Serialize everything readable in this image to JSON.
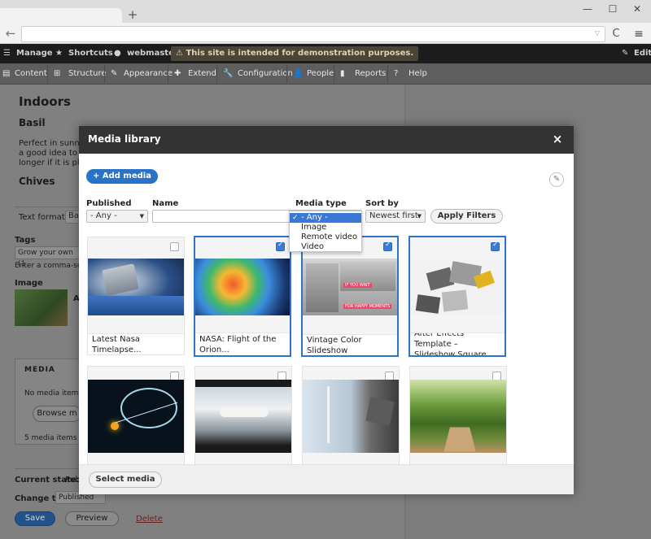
{
  "browser": {
    "new_tab": "+",
    "win_min": "—",
    "win_max": "☐",
    "win_close": "✕",
    "back": "←",
    "reload": "C",
    "menu": "≡",
    "omni_arrow": "▽"
  },
  "toolbar": {
    "manage": "Manage",
    "shortcuts": "Shortcuts",
    "user": "webmaster",
    "warning": "This site is intended for demonstration purposes.",
    "edit": "Edit"
  },
  "tray": {
    "items": [
      "Content",
      "Structure",
      "Appearance",
      "Extend",
      "Configuration",
      "People",
      "Reports",
      "Help"
    ]
  },
  "page": {
    "h_indoors": "Indoors",
    "h_basil": "Basil",
    "p1": "Perfect in sunny",
    "p2": "a good idea to ha",
    "p3": "longer if it is plac",
    "h_chives": "Chives",
    "text_format": "Text format",
    "text_format_val": "Ba",
    "tags": "Tags",
    "tags_val": "Grow your own (1",
    "tags_help": "Enter a comma-sepa",
    "image": "Image",
    "image_a": "A",
    "media": "MEDIA",
    "no_media": "No media items",
    "browse": "Browse m",
    "count": "5 media items re",
    "current_state": "Current state:",
    "current_state_val": "Publ",
    "change_to": "Change to:",
    "change_to_val": "Published",
    "save": "Save",
    "preview": "Preview",
    "delete": "Delete"
  },
  "modal": {
    "title": "Media library",
    "close": "×",
    "add_media": "+ Add media",
    "filters": {
      "published_label": "Published",
      "published_value": "- Any -",
      "name_label": "Name",
      "media_type_label": "Media type",
      "media_type_options": [
        "- Any -",
        "Image",
        "Remote video",
        "Video"
      ],
      "sort_label": "Sort by",
      "sort_value": "Newest first",
      "apply": "Apply Filters"
    },
    "items": [
      {
        "caption": "Latest Nasa Timelapse...",
        "selected": false
      },
      {
        "caption": "NASA: Flight of the Orion...",
        "selected": true
      },
      {
        "caption": "Vintage Color Slideshow",
        "selected": true
      },
      {
        "caption": "After Effects Template – Slideshow Square",
        "selected": true
      },
      {
        "caption": "",
        "selected": false
      },
      {
        "caption": "",
        "selected": false
      },
      {
        "caption": "",
        "selected": false
      },
      {
        "caption": "",
        "selected": false
      }
    ],
    "thumb_texts": {
      "if_you_wait": "IF YOU WAIT",
      "happy_moments": "FOR HAPPY MOMENTS"
    },
    "select_media": "Select media"
  },
  "colors": {
    "accent": "#2873c8",
    "selected_border": "#2f74c9",
    "modal_header": "#333333"
  }
}
